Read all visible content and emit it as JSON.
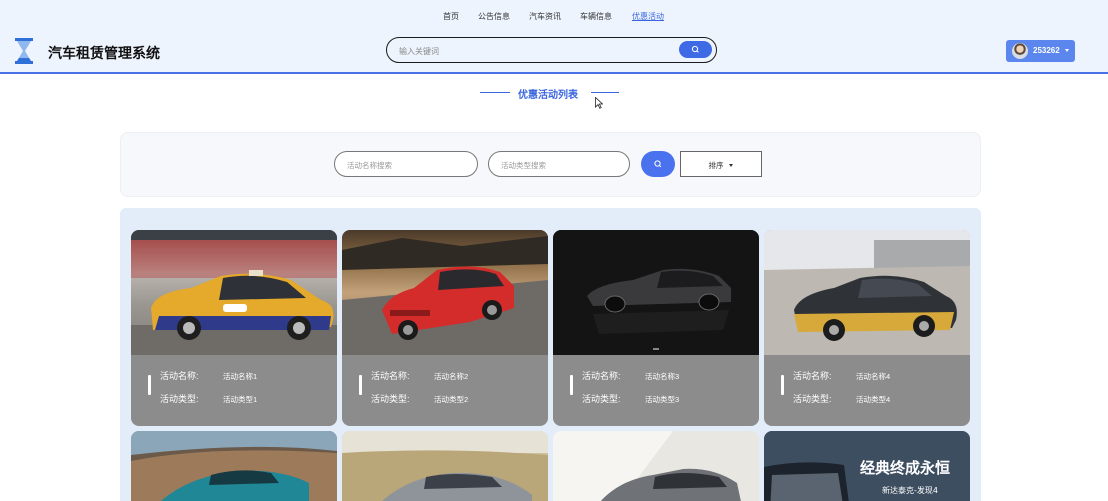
{
  "header": {
    "nav": [
      {
        "label": "首页",
        "active": false
      },
      {
        "label": "公告信息",
        "active": false
      },
      {
        "label": "汽车资讯",
        "active": false
      },
      {
        "label": "车辆信息",
        "active": false
      },
      {
        "label": "优惠活动",
        "active": true
      }
    ],
    "brand": "汽车租赁管理系统",
    "search_placeholder": "输入关键词",
    "username": "253262"
  },
  "page_title": "优惠活动列表",
  "filter": {
    "name_placeholder": "活动名称搜索",
    "type_placeholder": "活动类型搜索",
    "sort_label": "排序"
  },
  "cards": [
    {
      "name_label": "活动名称:",
      "name_value": "活动名称1",
      "type_label": "活动类型:",
      "type_value": "活动类型1"
    },
    {
      "name_label": "活动名称:",
      "name_value": "活动名称2",
      "type_label": "活动类型:",
      "type_value": "活动类型2"
    },
    {
      "name_label": "活动名称:",
      "name_value": "活动名称3",
      "type_label": "活动类型:",
      "type_value": "活动类型3"
    },
    {
      "name_label": "活动名称:",
      "name_value": "活动名称4",
      "type_label": "活动类型:",
      "type_value": "活动类型4"
    }
  ],
  "banner_text": {
    "headline": "经典终成永恒",
    "sub": "新达泰克-发现4"
  },
  "colors": {
    "accent": "#3f6ae6",
    "header_bg": "#eef4fd",
    "card_bg": "#8c8c8c"
  }
}
